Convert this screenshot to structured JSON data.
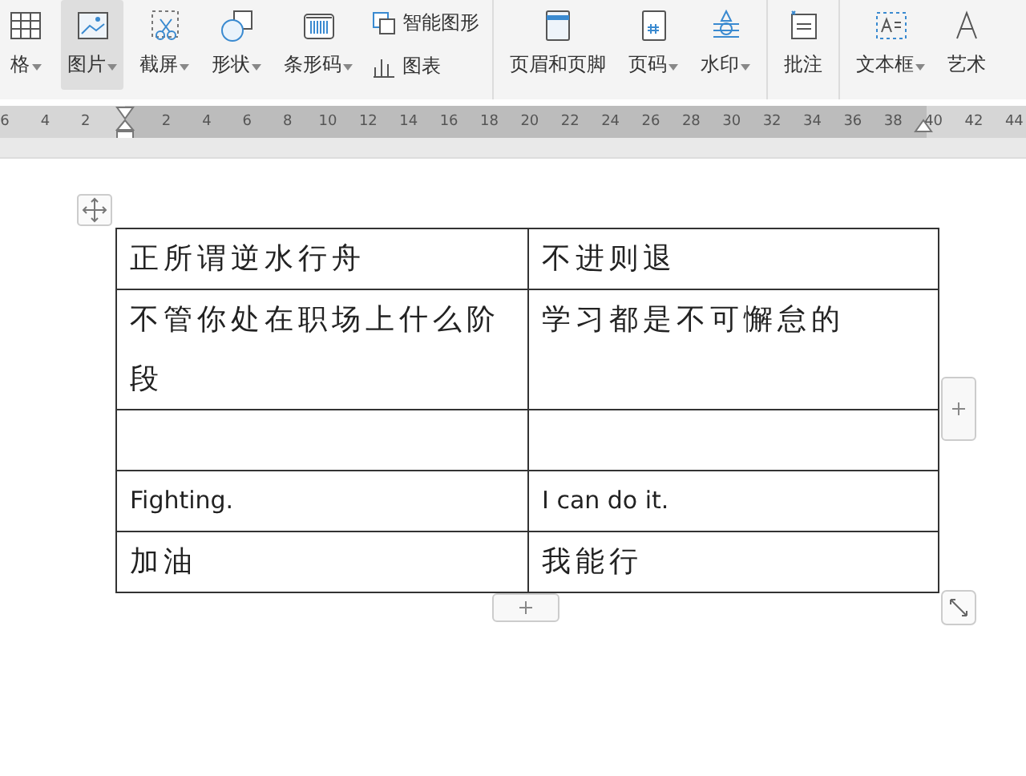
{
  "toolbar": {
    "groups": [
      {
        "items": [
          {
            "kind": "large",
            "label": "格",
            "dropdown": true,
            "selected": false
          },
          {
            "kind": "large",
            "label": "图片",
            "dropdown": true,
            "selected": true
          },
          {
            "kind": "large",
            "label": "截屏",
            "dropdown": true,
            "selected": false
          },
          {
            "kind": "large",
            "label": "形状",
            "dropdown": true,
            "selected": false
          },
          {
            "kind": "large",
            "label": "条形码",
            "dropdown": true,
            "selected": false
          },
          {
            "kind": "stack",
            "entries": [
              {
                "label": "智能图形"
              },
              {
                "label": "图表"
              }
            ]
          }
        ]
      },
      {
        "items": [
          {
            "kind": "large",
            "label": "页眉和页脚",
            "dropdown": false,
            "selected": false
          },
          {
            "kind": "large",
            "label": "页码",
            "dropdown": true,
            "selected": false
          },
          {
            "kind": "large",
            "label": "水印",
            "dropdown": true,
            "selected": false
          }
        ]
      },
      {
        "items": [
          {
            "kind": "large",
            "label": "批注",
            "dropdown": false,
            "selected": false
          }
        ]
      },
      {
        "items": [
          {
            "kind": "large",
            "label": "文本框",
            "dropdown": true,
            "selected": false
          },
          {
            "kind": "large",
            "label": "艺术",
            "dropdown": false,
            "selected": false
          }
        ]
      }
    ]
  },
  "ruler": {
    "left_numbers": [
      "6",
      "4",
      "2"
    ],
    "right_numbers": [
      "2",
      "4",
      "6",
      "8",
      "10",
      "12",
      "14",
      "16",
      "18",
      "20",
      "22",
      "24",
      "26",
      "28",
      "30",
      "32",
      "34",
      "36",
      "38",
      "40",
      "42",
      "44"
    ]
  },
  "table": {
    "rows": [
      {
        "cells": [
          {
            "text": "正所谓逆水行舟"
          },
          {
            "text": "不进则退"
          }
        ]
      },
      {
        "cells": [
          {
            "text": "不管你处在职场上什么阶段"
          },
          {
            "text": "学习都是不可懈怠的"
          }
        ]
      },
      {
        "cells": [
          {},
          {}
        ]
      },
      {
        "cells": [
          {
            "text": "Fighting."
          },
          {
            "text": "I can do it."
          }
        ]
      },
      {
        "cells": [
          {
            "text": "加油"
          },
          {
            "text": "我能行"
          }
        ]
      }
    ]
  }
}
